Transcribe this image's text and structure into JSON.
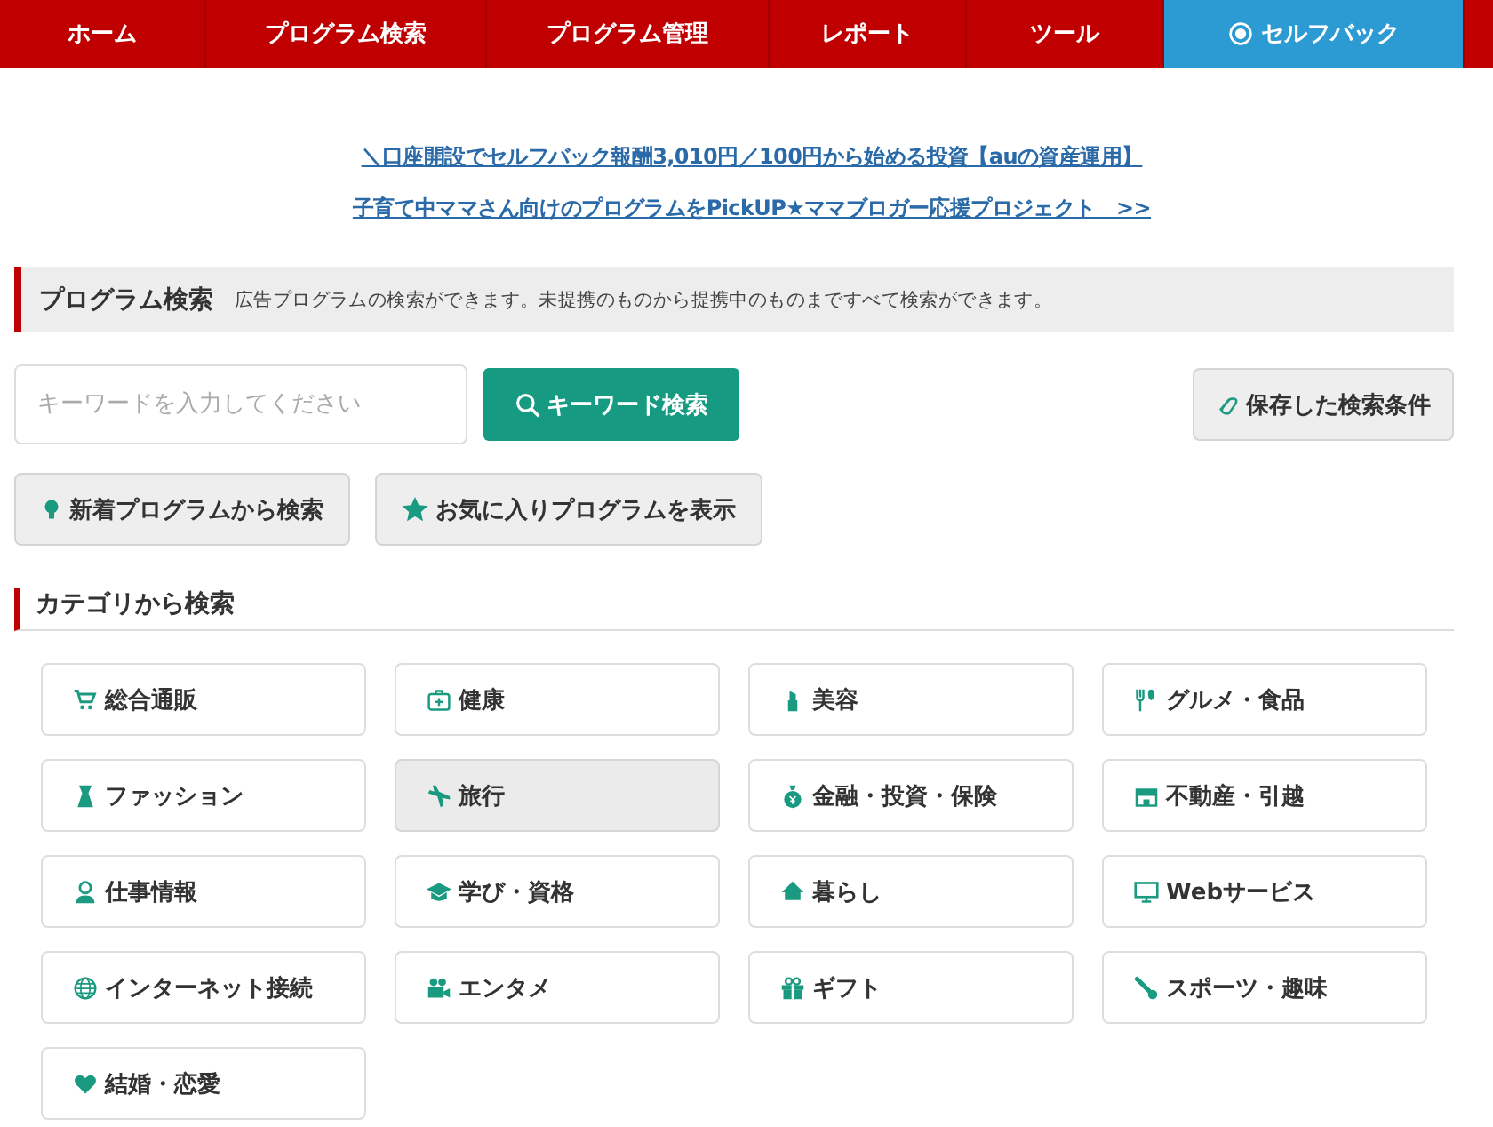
{
  "nav": [
    {
      "label": "ホーム",
      "selected": false
    },
    {
      "label": "プログラム検索",
      "selected": false
    },
    {
      "label": "プログラム管理",
      "selected": false
    },
    {
      "label": "レポート",
      "selected": false
    },
    {
      "label": "ツール",
      "selected": false
    },
    {
      "label": "セルフバック",
      "selected": true
    }
  ],
  "promo_links": [
    "＼口座開設でセルフバック報酬3,010円／100円から始める投資【auの資産運用】",
    "子育て中ママさん向けのプログラムをPickUP★ママブロガー応援プロジェクト　>>"
  ],
  "search_section": {
    "title": "プログラム検索",
    "description": "広告プログラムの検索ができます。未提携のものから提携中のものまですべて検索ができます。"
  },
  "search": {
    "placeholder": "キーワードを入力してください",
    "button": "キーワード検索",
    "saved_button": "保存した検索条件"
  },
  "quick_buttons": [
    "新着プログラムから検索",
    "お気に入りプログラムを表示"
  ],
  "category_section": {
    "title": "カテゴリから検索"
  },
  "categories": [
    {
      "label": "総合通販",
      "highlighted": false
    },
    {
      "label": "健康",
      "highlighted": false
    },
    {
      "label": "美容",
      "highlighted": false
    },
    {
      "label": "グルメ・食品",
      "highlighted": false
    },
    {
      "label": "ファッション",
      "highlighted": false
    },
    {
      "label": "旅行",
      "highlighted": true
    },
    {
      "label": "金融・投資・保険",
      "highlighted": false
    },
    {
      "label": "不動産・引越",
      "highlighted": false
    },
    {
      "label": "仕事情報",
      "highlighted": false
    },
    {
      "label": "学び・資格",
      "highlighted": false
    },
    {
      "label": "暮らし",
      "highlighted": false
    },
    {
      "label": "Webサービス",
      "highlighted": false
    },
    {
      "label": "インターネット接続",
      "highlighted": false
    },
    {
      "label": "エンタメ",
      "highlighted": false
    },
    {
      "label": "ギフト",
      "highlighted": false
    },
    {
      "label": "スポーツ・趣味",
      "highlighted": false
    },
    {
      "label": "結婚・恋愛",
      "highlighted": false
    }
  ]
}
